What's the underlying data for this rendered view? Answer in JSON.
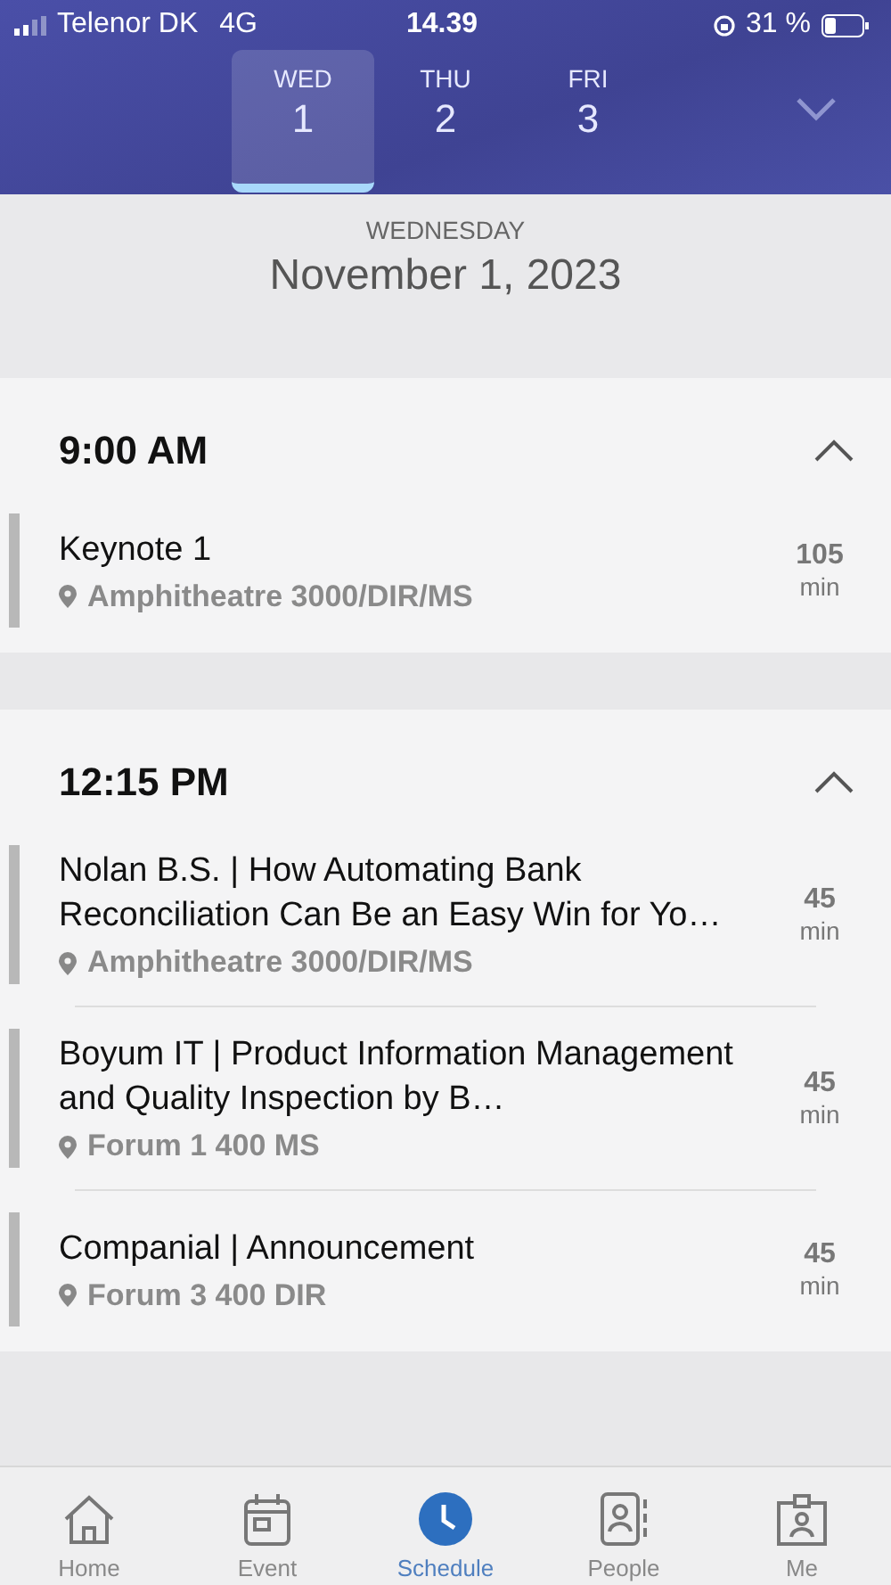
{
  "status_bar": {
    "carrier": "Telenor DK",
    "network": "4G",
    "time": "14.39",
    "battery": "31 %"
  },
  "days": [
    {
      "weekday": "WED",
      "day": "1",
      "selected": true
    },
    {
      "weekday": "THU",
      "day": "2",
      "selected": false
    },
    {
      "weekday": "FRI",
      "day": "3",
      "selected": false
    }
  ],
  "date_header": {
    "weekday": "WEDNESDAY",
    "date": "November 1, 2023"
  },
  "sections": [
    {
      "time": "9:00 AM",
      "expanded": true,
      "sessions": [
        {
          "title": "Keynote 1",
          "location": "Amphitheatre 3000/DIR/MS",
          "duration": "105",
          "unit": "min"
        }
      ]
    },
    {
      "time": "12:15 PM",
      "expanded": true,
      "sessions": [
        {
          "title": "Nolan B.S. | How Automating Bank Reconciliation Can Be an Easy Win for Yo…",
          "location": "Amphitheatre 3000/DIR/MS",
          "duration": "45",
          "unit": "min"
        },
        {
          "title": "Boyum IT | Product Information Management and Quality Inspection by B…",
          "location": "Forum 1 400 MS",
          "duration": "45",
          "unit": "min"
        },
        {
          "title": "Companial | Announcement",
          "location": "Forum 3 400 DIR",
          "duration": "45",
          "unit": "min"
        }
      ]
    }
  ],
  "tabs": [
    {
      "label": "Home",
      "kind": "home",
      "selected": false
    },
    {
      "label": "Event",
      "kind": "event",
      "selected": false
    },
    {
      "label": "Schedule",
      "kind": "schedule",
      "selected": true
    },
    {
      "label": "People",
      "kind": "people",
      "selected": false
    },
    {
      "label": "Me",
      "kind": "me",
      "selected": false
    }
  ]
}
